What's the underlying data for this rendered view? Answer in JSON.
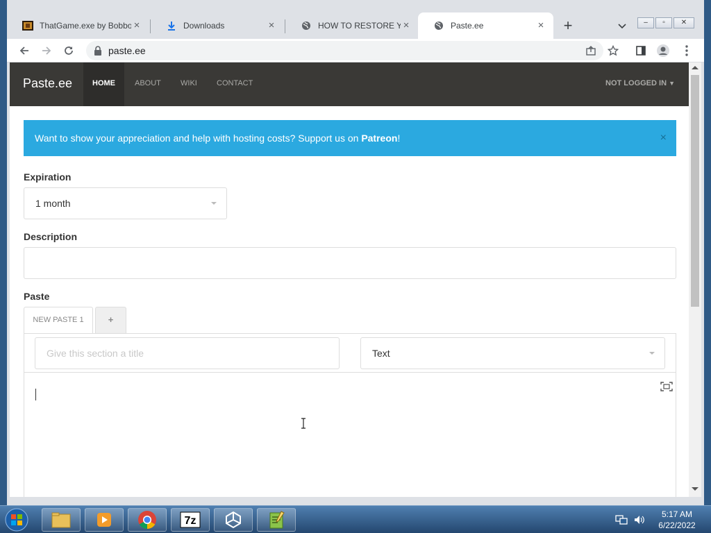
{
  "tabs": [
    {
      "title": "ThatGame.exe by Bobbo",
      "icon": "game-icon",
      "active": false
    },
    {
      "title": "Downloads",
      "icon": "download-icon",
      "active": false
    },
    {
      "title": "HOW TO RESTORE YOU",
      "icon": "globe-icon",
      "active": false
    },
    {
      "title": "Paste.ee",
      "icon": "globe-icon",
      "active": true
    }
  ],
  "toolbar": {
    "url": "paste.ee"
  },
  "site": {
    "brand": "Paste.ee",
    "nav": [
      "HOME",
      "ABOUT",
      "WIKI",
      "CONTACT"
    ],
    "user_menu": "NOT LOGGED IN"
  },
  "banner": {
    "text": "Want to show your appreciation and help with hosting costs? Support us on ",
    "link": "Patreon",
    "suffix": "!",
    "close": "×",
    "color": "#2ba9e0"
  },
  "form": {
    "expiration_label": "Expiration",
    "expiration_value": "1 month",
    "description_label": "Description",
    "description_value": "",
    "paste_label": "Paste",
    "paste_tab": "NEW PASTE 1",
    "add_tab": "+",
    "section_title_placeholder": "Give this section a title",
    "syntax_value": "Text"
  },
  "taskbar": {
    "time": "5:17 AM",
    "date": "6/22/2022",
    "apps": [
      "explorer",
      "media-player",
      "chrome",
      "7zip",
      "unity",
      "notepad"
    ]
  }
}
